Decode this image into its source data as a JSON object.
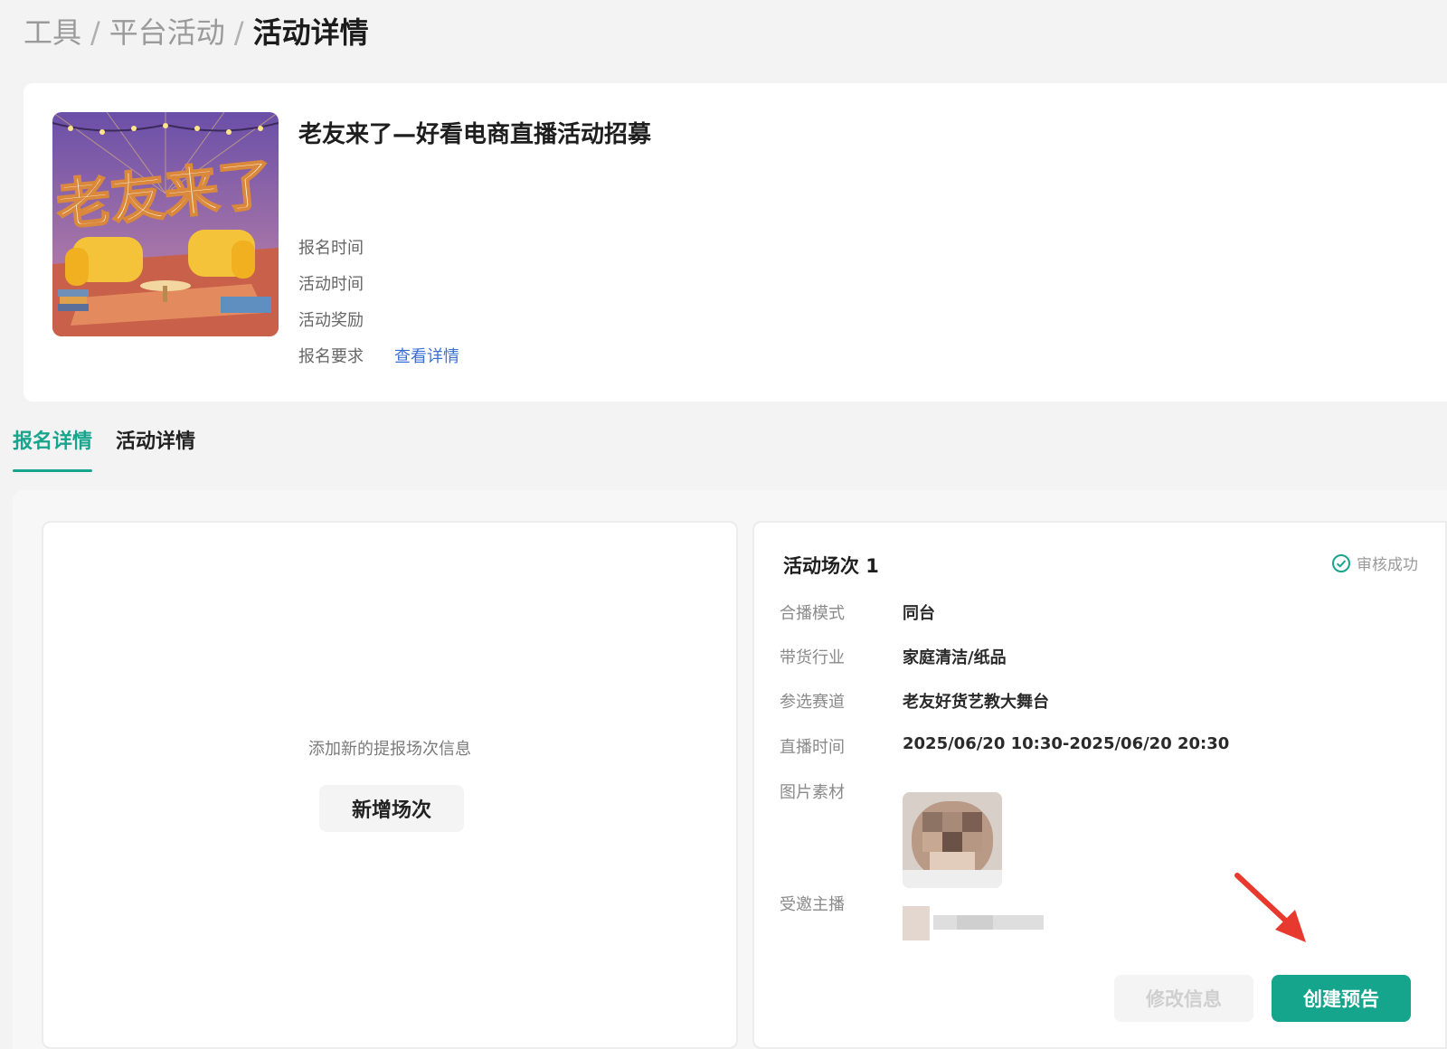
{
  "breadcrumb": {
    "items": [
      "工具",
      "平台活动"
    ],
    "separator": "/",
    "current": "活动详情"
  },
  "activity": {
    "poster_text": "老友来了",
    "title": "老友来了—好看电商直播活动招募",
    "rows": [
      {
        "label": "报名时间"
      },
      {
        "label": "活动时间"
      },
      {
        "label": "活动奖励"
      },
      {
        "label": "报名要求",
        "link": "查看详情"
      }
    ]
  },
  "tabs": [
    {
      "label": "报名详情",
      "active": true
    },
    {
      "label": "活动详情",
      "active": false
    }
  ],
  "add_session": {
    "hint": "添加新的提报场次信息",
    "button": "新增场次"
  },
  "session": {
    "title": "活动场次 1",
    "status": "审核成功",
    "fields": [
      {
        "label": "合播模式",
        "value": "同台"
      },
      {
        "label": "带货行业",
        "value": "家庭清洁/纸品"
      },
      {
        "label": "参选赛道",
        "value": "老友好货艺教大舞台"
      },
      {
        "label": "直播时间",
        "value": "2025/06/20 10:30-2025/06/20 20:30"
      },
      {
        "label": "图片素材"
      },
      {
        "label": "受邀主播"
      }
    ],
    "edit_button": "修改信息",
    "create_button": "创建预告"
  },
  "colors": {
    "accent": "#14a58c",
    "link": "#3a6fd8",
    "arrow": "#e8392f"
  }
}
